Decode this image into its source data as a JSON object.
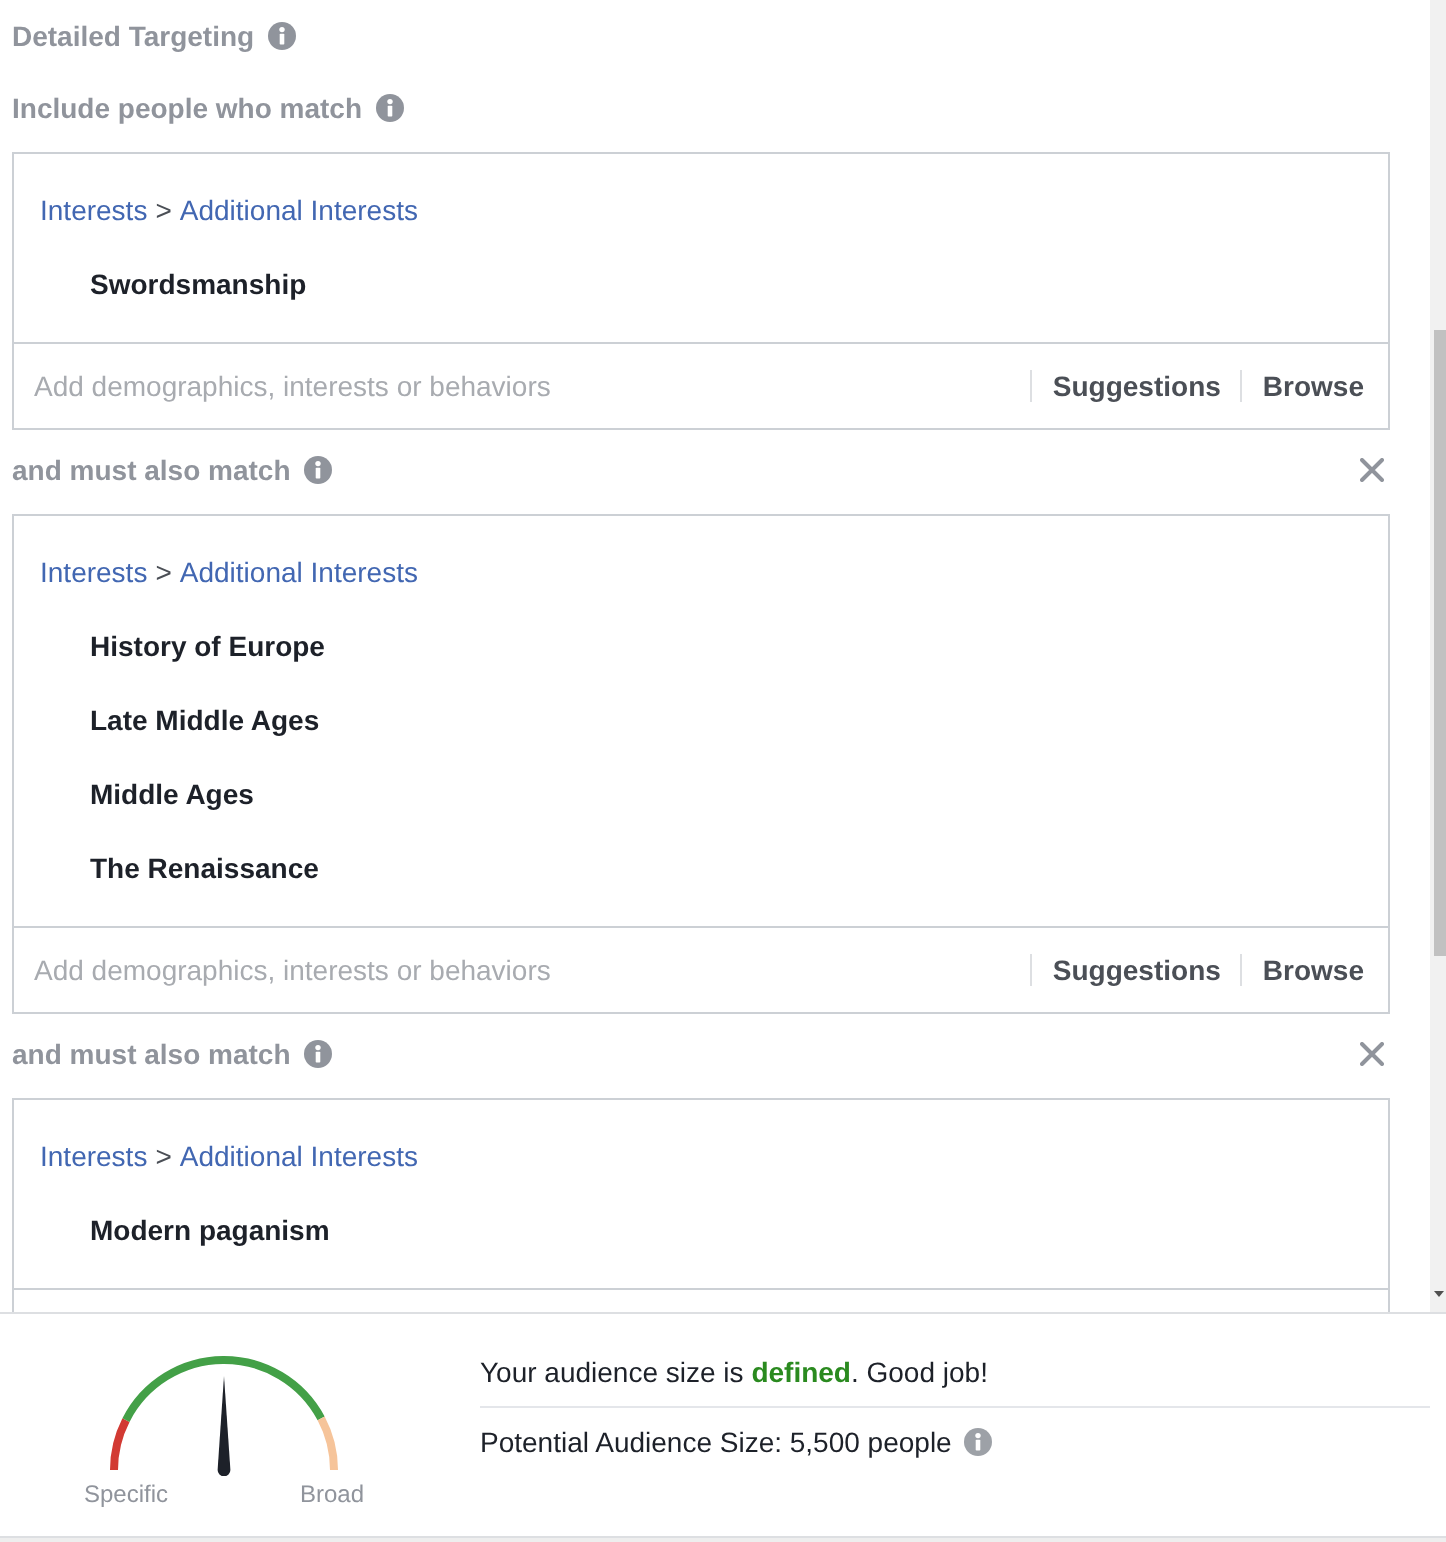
{
  "section": {
    "title": "Detailed Targeting"
  },
  "groups": [
    {
      "label": "Include people who match",
      "removable": false,
      "breadcrumb": {
        "category": "Interests",
        "separator": ">",
        "subcategory": "Additional Interests"
      },
      "items": [
        "Swordsmanship"
      ],
      "input": {
        "placeholder": "Add demographics, interests or behaviors",
        "actions": [
          "Suggestions",
          "Browse"
        ]
      }
    },
    {
      "label": "and must also match",
      "removable": true,
      "breadcrumb": {
        "category": "Interests",
        "separator": ">",
        "subcategory": "Additional Interests"
      },
      "items": [
        "History of Europe",
        "Late Middle Ages",
        "Middle Ages",
        "The Renaissance"
      ],
      "input": {
        "placeholder": "Add demographics, interests or behaviors",
        "actions": [
          "Suggestions",
          "Browse"
        ]
      }
    },
    {
      "label": "and must also match",
      "removable": true,
      "breadcrumb": {
        "category": "Interests",
        "separator": ">",
        "subcategory": "Additional Interests"
      },
      "items": [
        "Modern paganism"
      ]
    }
  ],
  "audience": {
    "gauge": {
      "level": 0.5,
      "labels": [
        "Specific",
        "Broad"
      ]
    },
    "status": "Your audience size is **defined**. Good job!",
    "size": "Potential Audience Size: 5,500 people"
  }
}
